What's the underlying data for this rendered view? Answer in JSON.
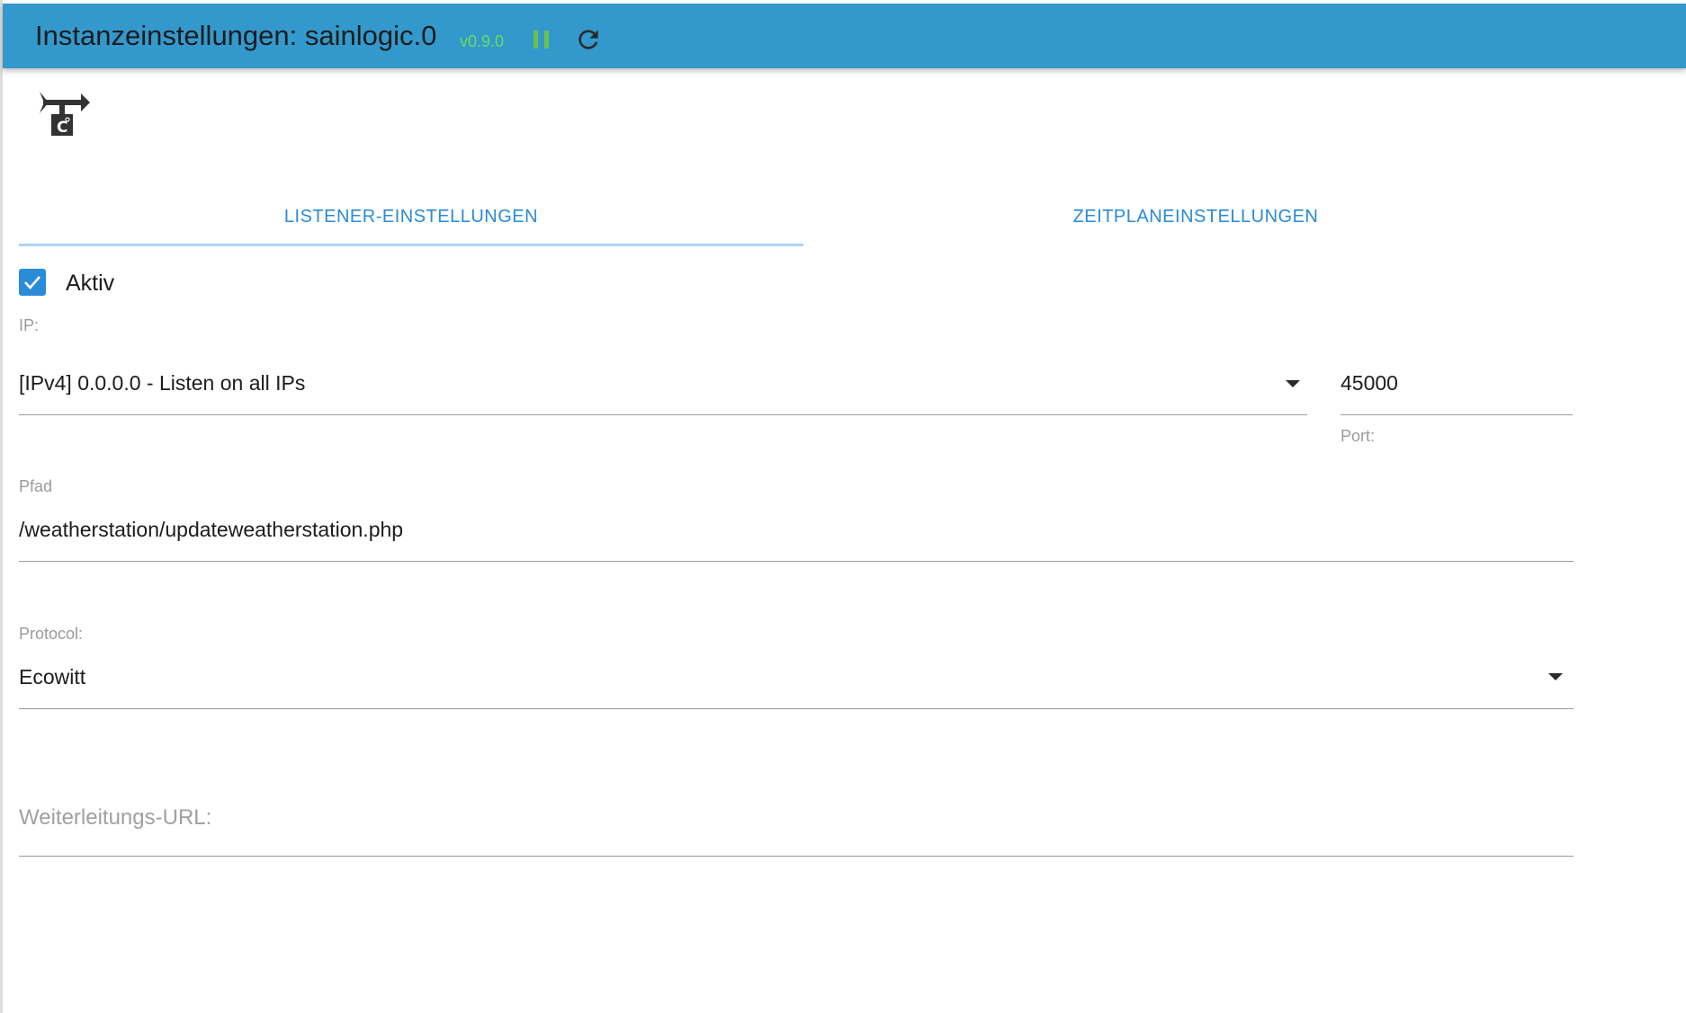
{
  "header": {
    "title": "Instanzeinstellungen: sainlogic.0",
    "version": "v0.9.0",
    "pause_icon": "pause-icon",
    "reload_icon": "reload-icon",
    "background_color": "#3399cc",
    "version_color": "#6cdc60"
  },
  "logo": {
    "icon": "weather-vane-logo-icon"
  },
  "tabs": [
    {
      "label": "LISTENER-EINSTELLUNGEN",
      "active": true
    },
    {
      "label": "ZEITPLANEINSTELLUNGEN",
      "active": false
    }
  ],
  "form": {
    "active": {
      "label": "Aktiv",
      "checked": true
    },
    "ip": {
      "label": "IP:",
      "value": "[IPv4] 0.0.0.0 - Listen on all IPs"
    },
    "port": {
      "label": "Port:",
      "value": "45000"
    },
    "path": {
      "label": "Pfad",
      "value": "/weatherstation/updateweatherstation.php"
    },
    "protocol": {
      "label": "Protocol:",
      "value": "Ecowitt"
    },
    "forward_url": {
      "placeholder": "Weiterleitungs-URL:",
      "value": ""
    }
  },
  "accent_color": "#2a8bd6"
}
